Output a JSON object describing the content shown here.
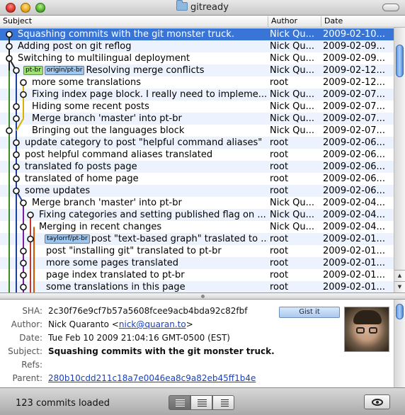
{
  "window": {
    "title": "gitready"
  },
  "columns": {
    "subject": "Subject",
    "author": "Author",
    "date": "Date"
  },
  "commits": [
    {
      "subject": "Squashing commits with the git monster truck.",
      "author": "Nick Qu...",
      "date": "2009-02-10...",
      "refs": []
    },
    {
      "subject": "Adding post on git reflog",
      "author": "Nick Qu...",
      "date": "2009-02-09...",
      "refs": []
    },
    {
      "subject": "Switching to multilingual deployment",
      "author": "Nick Qu...",
      "date": "2009-02-09...",
      "refs": []
    },
    {
      "subject": "Resolving merge conflicts",
      "author": "Nick Qu...",
      "date": "2009-02-12...",
      "refs": [
        {
          "label": "pt-br",
          "color": "#9be36c"
        },
        {
          "label": "origin/pt-br",
          "color": "#9dc6f0"
        }
      ]
    },
    {
      "subject": "more some translations",
      "author": "root",
      "date": "2009-02-12...",
      "refs": []
    },
    {
      "subject": "Fixing index page block. I really need to impleme...",
      "author": "Nick Qu...",
      "date": "2009-02-07...",
      "refs": []
    },
    {
      "subject": "Hiding some recent posts",
      "author": "Nick Qu...",
      "date": "2009-02-07...",
      "refs": []
    },
    {
      "subject": "Merge branch 'master' into pt-br",
      "author": "Nick Qu...",
      "date": "2009-02-07...",
      "refs": []
    },
    {
      "subject": "Bringing out the languages block",
      "author": "Nick Qu...",
      "date": "2009-02-07...",
      "refs": []
    },
    {
      "subject": "update category to post \"helpful command aliases\"",
      "author": "root",
      "date": "2009-02-06...",
      "refs": []
    },
    {
      "subject": "post helpful command aliases translated",
      "author": "root",
      "date": "2009-02-06...",
      "refs": []
    },
    {
      "subject": "translated fo posts page",
      "author": "root",
      "date": "2009-02-06...",
      "refs": []
    },
    {
      "subject": "translated of home page",
      "author": "root",
      "date": "2009-02-06...",
      "refs": []
    },
    {
      "subject": "some updates",
      "author": "root",
      "date": "2009-02-06...",
      "refs": []
    },
    {
      "subject": "Merge branch 'master' into pt-br",
      "author": "Nick Qu...",
      "date": "2009-02-04...",
      "refs": []
    },
    {
      "subject": "Fixing categories and setting published flag on ...",
      "author": "Nick Qu...",
      "date": "2009-02-04...",
      "refs": []
    },
    {
      "subject": "Merging in recent changes",
      "author": "Nick Qu...",
      "date": "2009-02-04...",
      "refs": []
    },
    {
      "subject": "post \"text-based graph\" traslated to ...",
      "author": "root",
      "date": "2009-02-01...",
      "refs": [
        {
          "label": "taylorrf/pt-br",
          "color": "#9dc6f0"
        }
      ]
    },
    {
      "subject": "post \"installing git\" translated to pt-br",
      "author": "root",
      "date": "2009-02-01...",
      "refs": []
    },
    {
      "subject": "more some pages translated",
      "author": "root",
      "date": "2009-02-01...",
      "refs": []
    },
    {
      "subject": "page index translated to pt-br",
      "author": "root",
      "date": "2009-02-01...",
      "refs": []
    },
    {
      "subject": "some translations in this page",
      "author": "root",
      "date": "2009-02-01...",
      "refs": []
    }
  ],
  "details": {
    "sha_label": "SHA:",
    "sha": "2c30f76e9cf7b57a5608fcee9acb4bda92c82fbf",
    "author_label": "Author:",
    "author_name": "Nick Quaranto <",
    "author_email": "nick@quaran.to",
    "author_close": ">",
    "date_label": "Date:",
    "date": "Tue Feb 10 2009 21:04:16 GMT-0500 (EST)",
    "subject_label": "Subject:",
    "subject": "Squashing commits with the git monster truck.",
    "refs_label": "Refs:",
    "parent_label": "Parent:",
    "parent": "280b10cdd211c18a7e0046ea8c9a82eb45ff1b4e",
    "gist_button": "Gist it"
  },
  "status": {
    "text": "123 commits loaded"
  },
  "colors": {
    "selection": "#3875d7",
    "alt_row": "#edf3fe",
    "link": "#1740c9"
  }
}
